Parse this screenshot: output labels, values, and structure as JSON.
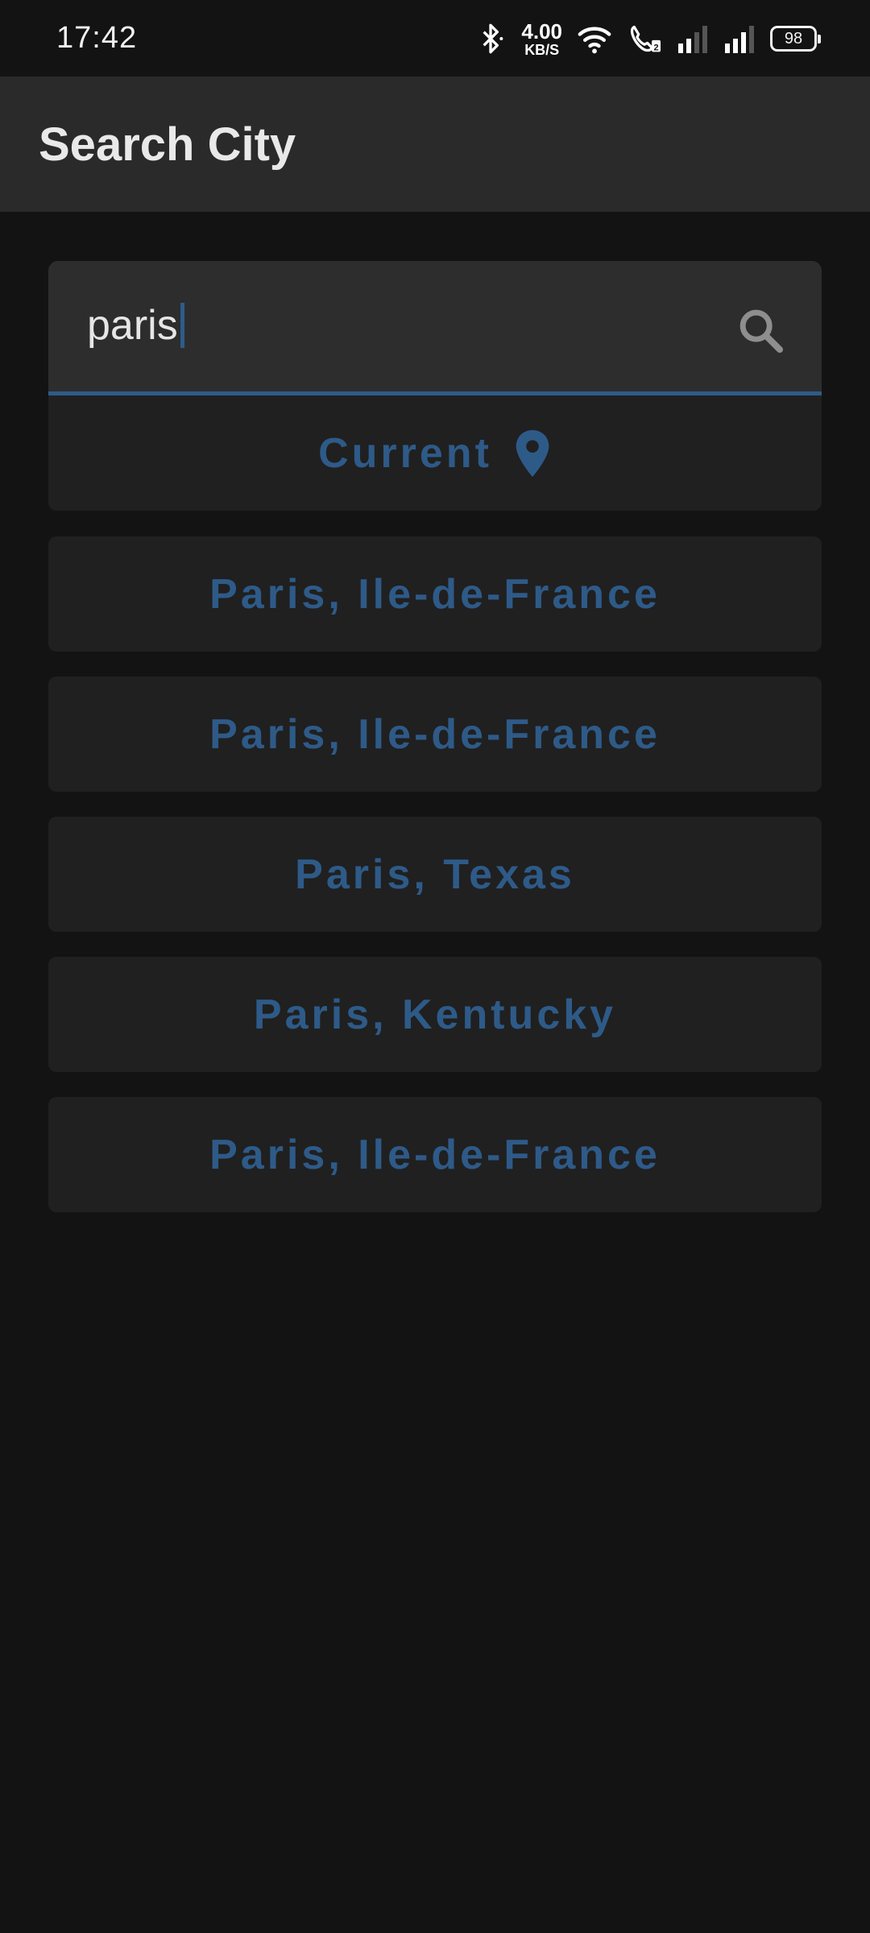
{
  "status_bar": {
    "time": "17:42",
    "net_speed_value": "4.00",
    "net_speed_unit": "KB/S",
    "battery": "98",
    "icons": [
      "bluetooth-icon",
      "wifi-icon",
      "wifi-call-icon",
      "signal-icon",
      "signal-icon"
    ]
  },
  "app_bar": {
    "title": "Search City"
  },
  "search": {
    "value": "paris",
    "icon": "search-icon"
  },
  "results": {
    "current_label": "Current",
    "current_icon": "location-pin-icon",
    "items": [
      "Paris, Ile-de-France",
      "Paris, Ile-de-France",
      "Paris, Texas",
      "Paris, Kentucky",
      "Paris, Ile-de-France"
    ]
  },
  "colors": {
    "background": "#131313",
    "app_bar": "#2a2a2a",
    "accent": "#2f5b8a",
    "card": "#202020"
  }
}
